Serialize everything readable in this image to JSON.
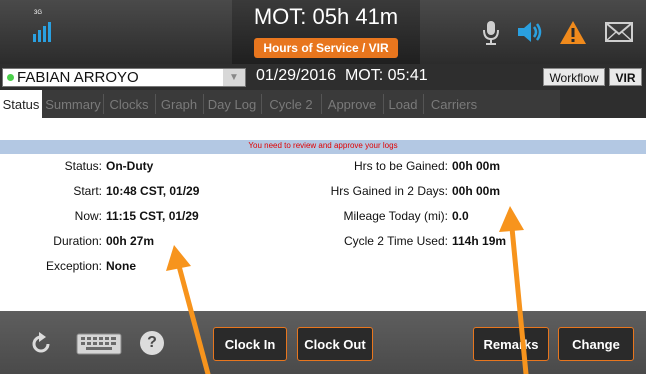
{
  "header": {
    "mot_title": "MOT: 05h 41m",
    "subtitle": "Hours of Service / VIR",
    "signal_label": "3G",
    "icons": [
      "mic-icon",
      "speaker-icon",
      "warning-icon",
      "mail-icon"
    ]
  },
  "driverbar": {
    "driver_name": "FABIAN ARROYO",
    "date_mot": "01/29/2016  MOT: 05:41",
    "workflow_label": "Workflow",
    "vir_label": "VIR"
  },
  "tabs": [
    "Status",
    "Summary",
    "Clocks",
    "Graph",
    "Day Log",
    "Cycle 2",
    "Approve",
    "Load",
    "Carriers"
  ],
  "notice": "You need to review and approve your logs",
  "status": {
    "left": [
      {
        "label": "Status:",
        "value": "On-Duty"
      },
      {
        "label": "Start:",
        "value": "10:48 CST, 01/29"
      },
      {
        "label": "Now:",
        "value": "11:15 CST, 01/29"
      },
      {
        "label": "Duration:",
        "value": "00h 27m"
      },
      {
        "label": "Exception:",
        "value": "None"
      }
    ],
    "right": [
      {
        "label": "Hrs to be Gained:",
        "value": "00h 00m"
      },
      {
        "label": "Hrs Gained in 2 Days:",
        "value": "00h 00m"
      },
      {
        "label": "Mileage Today (mi):",
        "value": "0.0"
      },
      {
        "label": "Cycle 2 Time Used:",
        "value": "114h 19m"
      }
    ]
  },
  "bottom": {
    "clock_in": "Clock In",
    "clock_out": "Clock Out",
    "remarks": "Remarks",
    "change": "Change",
    "help_glyph": "?"
  },
  "colors": {
    "accent": "#e8761e",
    "notice_bg": "#b3c8e3",
    "notice_text": "#e00000",
    "signal": "#2aa0e0"
  }
}
